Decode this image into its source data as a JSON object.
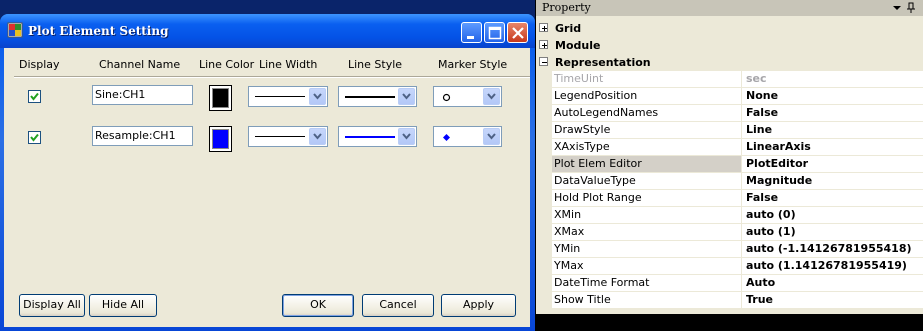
{
  "dialog": {
    "title": "Plot Element Setting",
    "headers": {
      "display": "Display",
      "channel": "Channel Name",
      "color": "Line Color",
      "width": "Line Width",
      "style": "Line Style",
      "marker": "Marker Style"
    },
    "rows": [
      {
        "checked": true,
        "channel": "Sine:CH1",
        "color": "#000000",
        "marker": "circle"
      },
      {
        "checked": true,
        "channel": "Resample:CH1",
        "color": "#0000ff",
        "marker": "diamond"
      }
    ],
    "buttons": {
      "display_all": "Display All",
      "hide_all": "Hide All",
      "ok": "OK",
      "cancel": "Cancel",
      "apply": "Apply"
    }
  },
  "property": {
    "title": "Property",
    "categories": [
      "Grid",
      "Module",
      "Representation"
    ],
    "rows": [
      {
        "key": "TimeUint",
        "value": "sec",
        "disabled": true
      },
      {
        "key": "LegendPosition",
        "value": "None"
      },
      {
        "key": "AutoLegendNames",
        "value": "False"
      },
      {
        "key": "DrawStyle",
        "value": "Line"
      },
      {
        "key": "XAxisType",
        "value": "LinearAxis"
      },
      {
        "key": "Plot Elem Editor",
        "value": "PlotEditor",
        "selected": true
      },
      {
        "key": "DataValueType",
        "value": "Magnitude"
      },
      {
        "key": "Hold Plot Range",
        "value": "False"
      },
      {
        "key": "XMin",
        "value": "auto (0)"
      },
      {
        "key": "XMax",
        "value": "auto (1)"
      },
      {
        "key": "YMin",
        "value": "auto (-1.14126781955418)"
      },
      {
        "key": "YMax",
        "value": "auto (1.14126781955419)"
      },
      {
        "key": "DateTime Format",
        "value": "Auto"
      },
      {
        "key": "Show Title",
        "value": "True"
      }
    ]
  }
}
